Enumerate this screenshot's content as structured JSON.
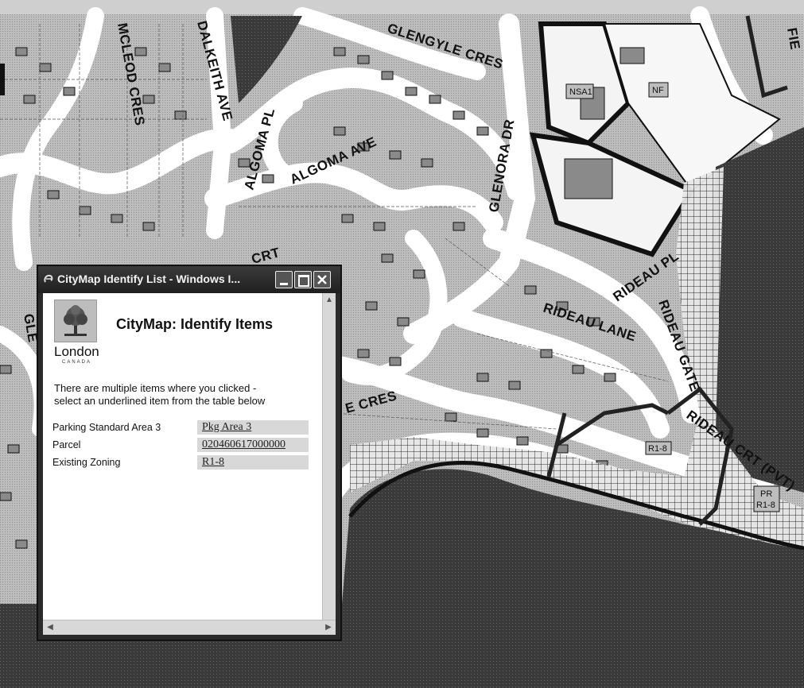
{
  "map": {
    "streets": [
      "MCLEOD CRES",
      "DALKEITH AVE",
      "GLENGYLE CRES",
      "ALGOMA PL",
      "ALGOMA AVE",
      "GLENORA DR",
      "CRT",
      "RIDEAU PL",
      "RIDEAU LANE",
      "RIDEAU GATE",
      "RIDEAU CRT (PVT)",
      "E CRES",
      "GLE",
      "FIE"
    ],
    "zone_tags": [
      "NSA1",
      "NF",
      "R1-8",
      "PR",
      "R1-8"
    ]
  },
  "window": {
    "title": "CityMap Identify List - Windows I...",
    "logo_city": "London",
    "logo_country": "CANADA",
    "heading": "CityMap: Identify Items",
    "message_line1": "There are multiple items where you clicked -",
    "message_line2": "select an underlined item from the table below",
    "items": [
      {
        "label": "Parking Standard Area 3",
        "link": "Pkg Area 3"
      },
      {
        "label": "Parcel",
        "link": "020460617000000"
      },
      {
        "label": "Existing Zoning",
        "link": "R1-8"
      }
    ]
  },
  "colors": {
    "map_background": "#b9b9b9",
    "street": "#ffffff",
    "water": "#2f2f2f",
    "building": "#8a8a8a",
    "title_bar": "#2b2b2b",
    "link_bg": "#d8d8d8"
  }
}
